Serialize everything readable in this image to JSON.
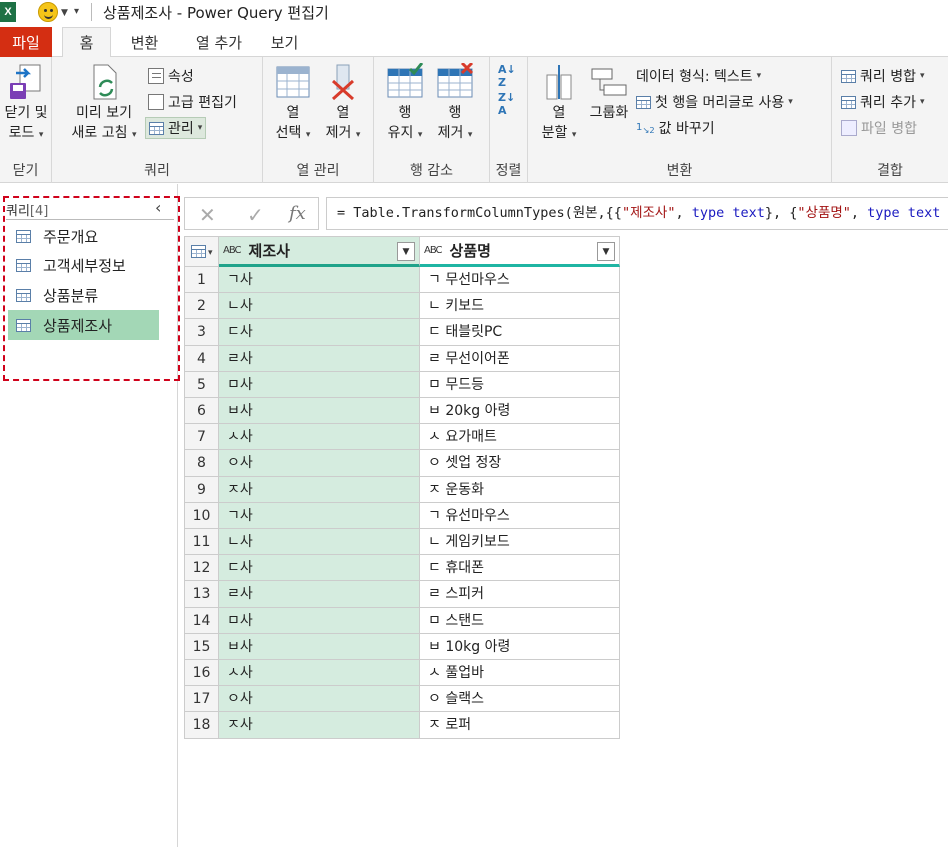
{
  "window": {
    "title": "상품제조사 - Power Query 편집기"
  },
  "tabs": [
    "파일",
    "홈",
    "변환",
    "열 추가",
    "보기"
  ],
  "ribbon": {
    "close": {
      "label_line1": "닫기 및",
      "label_line2": "로드",
      "group": "닫기"
    },
    "query": {
      "refresh_line1": "미리 보기",
      "refresh_line2": "새로 고침",
      "properties": "속성",
      "advanced_editor": "고급 편집기",
      "manage": "관리",
      "group": "쿼리"
    },
    "columns": {
      "choose_line1": "열",
      "choose_line2": "선택",
      "remove_line1": "열",
      "remove_line2": "제거",
      "group": "열 관리"
    },
    "rows": {
      "keep_line1": "행",
      "keep_line2": "유지",
      "remove_line1": "행",
      "remove_line2": "제거",
      "group": "행 감소"
    },
    "sort": {
      "group": "정렬"
    },
    "transform": {
      "split_line1": "열",
      "split_line2": "분할",
      "group_by": "그룹화",
      "data_type": "데이터 형식: 텍스트",
      "first_row_header": "첫 행을 머리글로 사용",
      "replace_values": "값 바꾸기",
      "group": "변환"
    },
    "combine": {
      "merge": "쿼리 병합",
      "append": "쿼리 추가",
      "combine_files": "파일 병합",
      "group": "결합"
    }
  },
  "queries": {
    "header": "쿼리",
    "count": "[4]",
    "items": [
      {
        "label": "주문개요"
      },
      {
        "label": "고객세부정보"
      },
      {
        "label": "상품분류"
      },
      {
        "label": "상품제조사",
        "active": true
      }
    ]
  },
  "formula": {
    "prefix": "= Table.TransformColumnTypes(원본,{{",
    "s1": "\"제조사\"",
    "mid1": ", ",
    "kw1": "type text",
    "mid2": "}, {",
    "s2": "\"상품명\"",
    "mid3": ", ",
    "kw2": "type text"
  },
  "grid": {
    "columns": [
      {
        "type": "ABC",
        "name": "제조사"
      },
      {
        "type": "ABC",
        "name": "상품명"
      }
    ],
    "rows": [
      [
        "ㄱ사",
        "ㄱ 무선마우스"
      ],
      [
        "ㄴ사",
        "ㄴ 키보드"
      ],
      [
        "ㄷ사",
        "ㄷ 태블릿PC"
      ],
      [
        "ㄹ사",
        "ㄹ 무선이어폰"
      ],
      [
        "ㅁ사",
        "ㅁ 무드등"
      ],
      [
        "ㅂ사",
        "ㅂ 20kg 아령"
      ],
      [
        "ㅅ사",
        "ㅅ 요가매트"
      ],
      [
        "ㅇ사",
        "ㅇ 셋업 정장"
      ],
      [
        "ㅈ사",
        "ㅈ 운동화"
      ],
      [
        "ㄱ사",
        "ㄱ 유선마우스"
      ],
      [
        "ㄴ사",
        "ㄴ 게임키보드"
      ],
      [
        "ㄷ사",
        "ㄷ 휴대폰"
      ],
      [
        "ㄹ사",
        "ㄹ 스피커"
      ],
      [
        "ㅁ사",
        "ㅁ 스탠드"
      ],
      [
        "ㅂ사",
        "ㅂ 10kg 아령"
      ],
      [
        "ㅅ사",
        "ㅅ 풀업바"
      ],
      [
        "ㅇ사",
        "ㅇ 슬랙스"
      ],
      [
        "ㅈ사",
        "ㅈ 로퍼"
      ]
    ]
  }
}
